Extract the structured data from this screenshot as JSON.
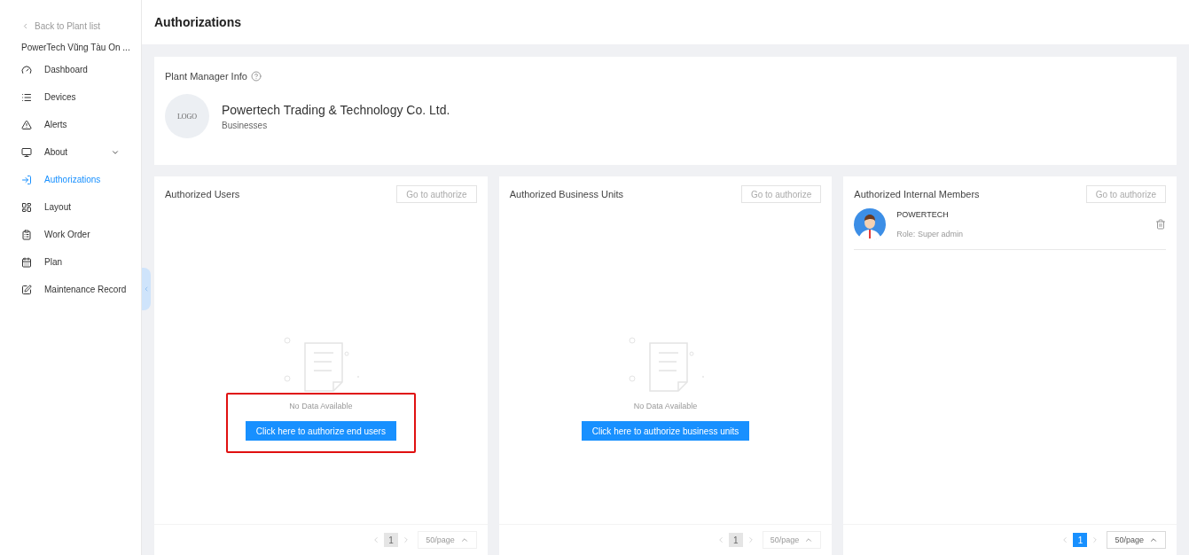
{
  "sidebar": {
    "back_link": "Back to Plant list",
    "plant_name": "PowerTech Vũng Tàu On ...",
    "items": [
      {
        "label": "Dashboard",
        "selected": false,
        "expandable": false
      },
      {
        "label": "Devices",
        "selected": false,
        "expandable": false
      },
      {
        "label": "Alerts",
        "selected": false,
        "expandable": false
      },
      {
        "label": "About",
        "selected": false,
        "expandable": true
      },
      {
        "label": "Authorizations",
        "selected": true,
        "expandable": false
      },
      {
        "label": "Layout",
        "selected": false,
        "expandable": false
      },
      {
        "label": "Work Order",
        "selected": false,
        "expandable": false
      },
      {
        "label": "Plan",
        "selected": false,
        "expandable": false
      },
      {
        "label": "Maintenance Record",
        "selected": false,
        "expandable": false
      }
    ]
  },
  "page_title": "Authorizations",
  "manager_info": {
    "title": "Plant Manager Info",
    "logo": "LOGO",
    "company": "Powertech Trading & Technology Co. Ltd.",
    "type": "Businesses"
  },
  "panels": [
    {
      "title": "Authorized Users",
      "action": "Go to authorize",
      "empty_text": "No Data Available",
      "cta": "Click here to authorize end users",
      "highlighted": true,
      "pagination": {
        "page": "1",
        "page_size": "50/page",
        "enabled": false
      }
    },
    {
      "title": "Authorized Business Units",
      "action": "Go to authorize",
      "empty_text": "No Data Available",
      "cta": "Click here to authorize business units",
      "pagination": {
        "page": "1",
        "page_size": "50/page",
        "enabled": false
      }
    },
    {
      "title": "Authorized Internal Members",
      "action": "Go to authorize",
      "members": [
        {
          "name": "POWERTECH",
          "role_label": "Role:",
          "role": "Super admin"
        }
      ],
      "pagination": {
        "page": "1",
        "page_size": "50/page",
        "enabled": true
      }
    }
  ]
}
